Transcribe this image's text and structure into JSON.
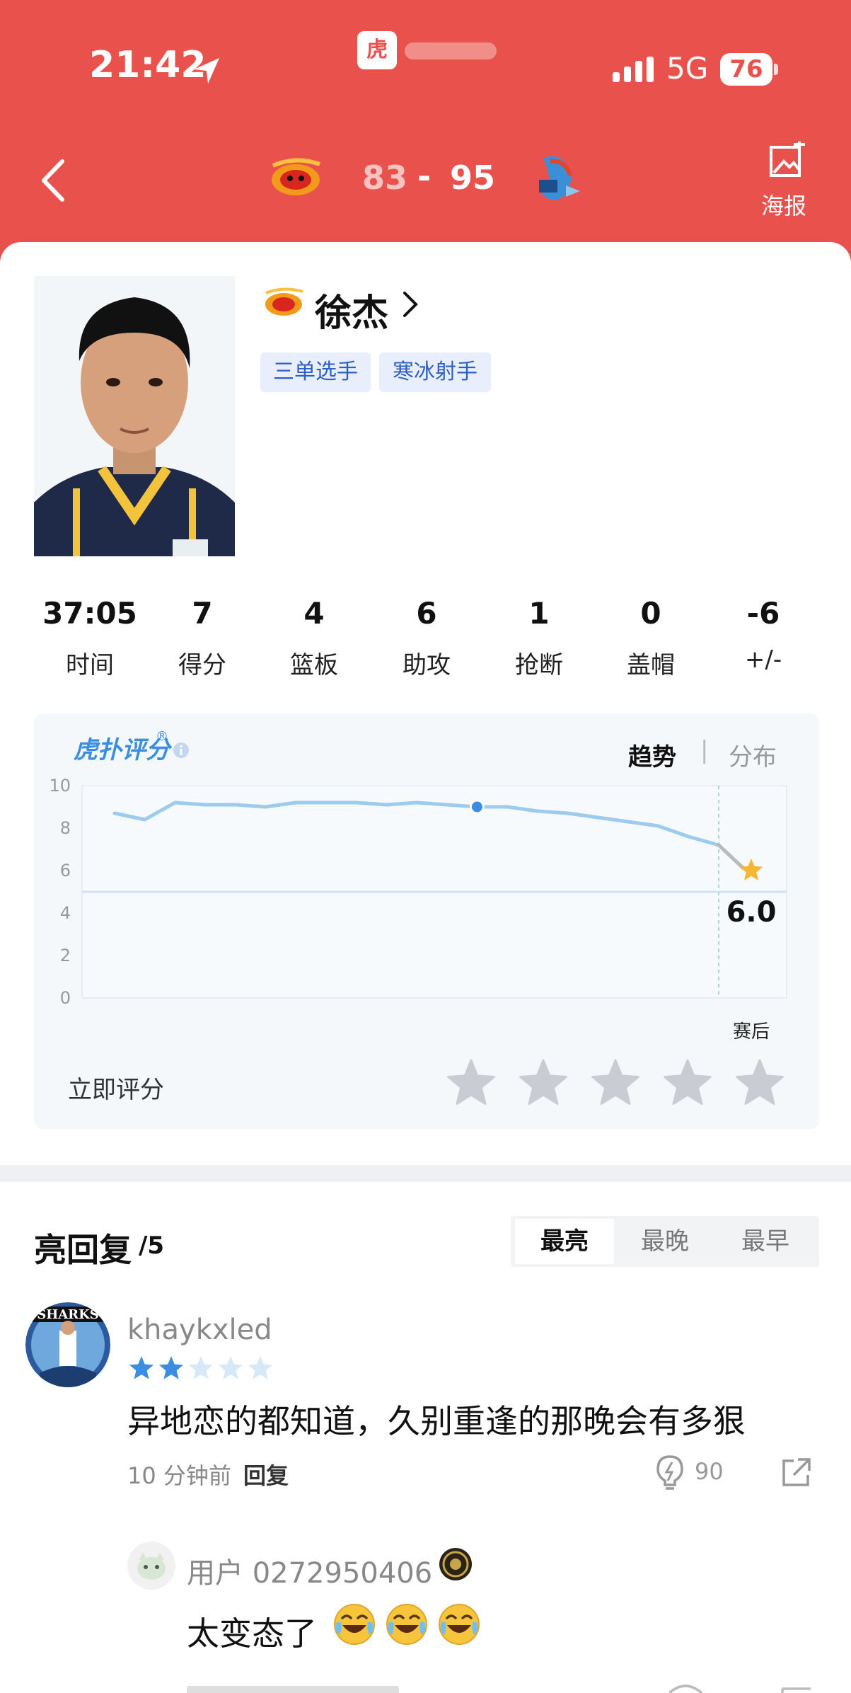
{
  "status_bar": {
    "time": "21:42",
    "network": "5G",
    "battery": "76",
    "app_logo_text": "虎扑"
  },
  "header": {
    "score_home": "83",
    "score_separator": "-",
    "score_away": "95",
    "poster_label": "海报"
  },
  "player": {
    "name": "徐杰",
    "tags": [
      "三单选手",
      "寒冰射手"
    ]
  },
  "stats": [
    {
      "value": "37:05",
      "label": "时间"
    },
    {
      "value": "7",
      "label": "得分"
    },
    {
      "value": "4",
      "label": "篮板"
    },
    {
      "value": "6",
      "label": "助攻"
    },
    {
      "value": "1",
      "label": "抢断"
    },
    {
      "value": "0",
      "label": "盖帽"
    },
    {
      "value": "-6",
      "label": "+/-"
    }
  ],
  "rating": {
    "logo_text": "虎扑评分",
    "logo_mark": "®",
    "tab_trend": "趋势",
    "tab_separator": "|",
    "tab_distribution": "分布",
    "rate_now_label": "立即评分",
    "star_count": 5
  },
  "chart_data": {
    "type": "line",
    "y_ticks": [
      "10",
      "8",
      "6",
      "4",
      "2",
      "0"
    ],
    "ylim": [
      0,
      10
    ],
    "reference_line": 5,
    "x_end_label": "赛后",
    "final_value_label": "6.0",
    "series": [
      {
        "values": [
          8.7,
          8.4,
          9.2,
          9.1,
          9.1,
          9.0,
          9.2,
          9.2,
          9.2,
          9.1,
          9.2,
          9.1,
          9.0,
          9.0,
          8.8,
          8.7,
          8.5,
          8.3,
          8.1,
          7.6,
          7.2
        ]
      }
    ],
    "highlight_index": 12,
    "final_value": 6.0,
    "line_color": "#9ccbee",
    "star_color": "#f4b731"
  },
  "replies": {
    "title": "亮回复",
    "count": "/5",
    "sort_options": [
      "最亮",
      "最晚",
      "最早"
    ],
    "comments": [
      {
        "user": "khaykxled",
        "rating_stars": 2,
        "text": "异地恋的都知道，久别重逢的那晚会有多狠",
        "time": "10 分钟前",
        "reply_label": "回复",
        "likes": "90"
      },
      {
        "user": "用户 0272950406",
        "text": "太变态了"
      }
    ]
  },
  "colors": {
    "brand": "#e9514d",
    "tag_bg": "#e8eefb",
    "tag_text": "#2e5fc4",
    "accent_blue": "#3a8de0"
  },
  "icons": {
    "location": "location-arrow-icon",
    "signal": "signal-bars-icon",
    "back": "chevron-left-icon",
    "poster": "image-icon",
    "info": "info-icon",
    "like": "lightbulb-icon",
    "share": "external-link-icon"
  }
}
